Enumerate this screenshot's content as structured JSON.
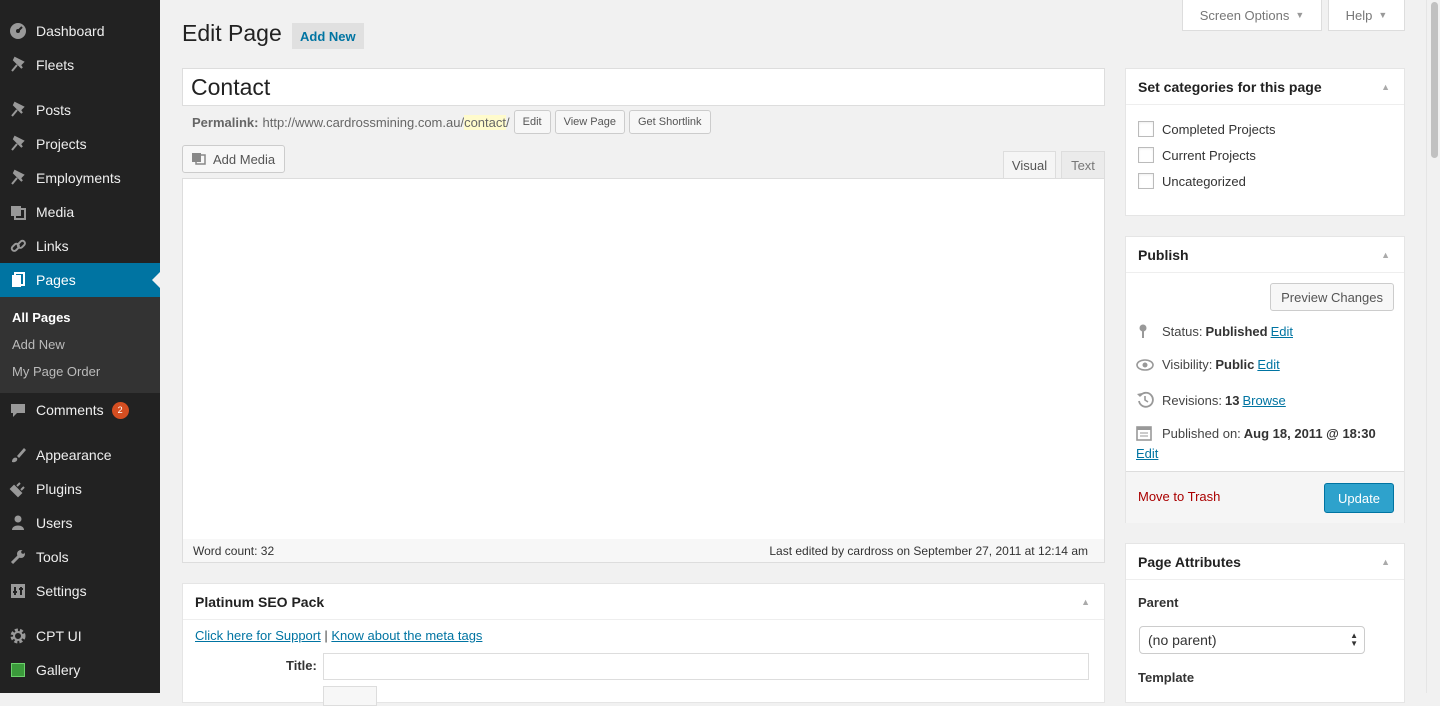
{
  "sidebar": {
    "items": [
      {
        "label": "Dashboard",
        "icon": "dashboard-icon"
      },
      {
        "label": "Fleets",
        "icon": "pin-icon"
      },
      {
        "label": "Posts",
        "icon": "pin-icon"
      },
      {
        "label": "Projects",
        "icon": "pin-icon"
      },
      {
        "label": "Employments",
        "icon": "pin-icon"
      },
      {
        "label": "Media",
        "icon": "media-icon"
      },
      {
        "label": "Links",
        "icon": "link-icon"
      },
      {
        "label": "Pages",
        "icon": "pages-icon"
      },
      {
        "label": "Comments",
        "icon": "comment-icon",
        "badge": "2"
      },
      {
        "label": "Appearance",
        "icon": "brush-icon"
      },
      {
        "label": "Plugins",
        "icon": "plugin-icon"
      },
      {
        "label": "Users",
        "icon": "user-icon"
      },
      {
        "label": "Tools",
        "icon": "wrench-icon"
      },
      {
        "label": "Settings",
        "icon": "settings-icon"
      },
      {
        "label": "CPT UI",
        "icon": "gear-icon"
      },
      {
        "label": "Gallery",
        "icon": "gallery-icon"
      }
    ],
    "submenu": [
      "All Pages",
      "Add New",
      "My Page Order"
    ]
  },
  "top": {
    "screen_options": "Screen Options",
    "help": "Help"
  },
  "heading": {
    "title": "Edit Page",
    "add_new": "Add New"
  },
  "post": {
    "title": "Contact",
    "permalink_label": "Permalink:",
    "permalink_base": "http://www.cardrossmining.com.au/",
    "permalink_slug": "contact",
    "permalink_trailing": "/",
    "edit_btn": "Edit",
    "view_btn": "View Page",
    "shortlink_btn": "Get Shortlink"
  },
  "editor": {
    "add_media": "Add Media",
    "tab_visual": "Visual",
    "tab_text": "Text",
    "word_count": "Word count: 32",
    "last_edited": "Last edited by cardross on September 27, 2011 at 12:14 am"
  },
  "seo": {
    "title": "Platinum SEO Pack",
    "support_link": "Click here for Support",
    "separator": "|",
    "meta_link": "Know about the meta tags",
    "title_label": "Title:"
  },
  "categories": {
    "title": "Set categories for this page",
    "items": [
      "Completed Projects",
      "Current Projects",
      "Uncategorized"
    ]
  },
  "publish": {
    "title": "Publish",
    "preview": "Preview Changes",
    "status_label": "Status:",
    "status_value": "Published",
    "visibility_label": "Visibility:",
    "visibility_value": "Public",
    "revisions_label": "Revisions:",
    "revisions_value": "13",
    "browse": "Browse",
    "published_label": "Published on:",
    "published_value": "Aug 18, 2011 @ 18:30",
    "edit": "Edit",
    "trash": "Move to Trash",
    "update": "Update"
  },
  "attributes": {
    "title": "Page Attributes",
    "parent_label": "Parent",
    "parent_value": "(no parent)",
    "template_label": "Template"
  }
}
